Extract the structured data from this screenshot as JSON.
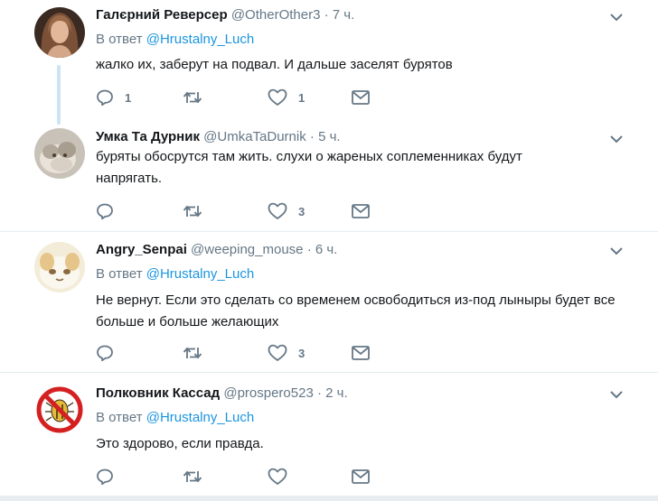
{
  "tweets": [
    {
      "name": "Галєрний Реверсер",
      "handle": "@OtherOther3",
      "dot": "·",
      "time": "7 ч.",
      "reply_prefix": "В ответ",
      "reply_mention": "@Hrustalny_Luch",
      "text": "жалко их, заберут на подвал. И дальше заселят бурятов",
      "replies": "1",
      "retweets": "",
      "likes": "1"
    },
    {
      "name": "Умка Та Дурник",
      "handle": "@UmkaTaDurnik",
      "dot": "·",
      "time": "5 ч.",
      "text": "буряты обосрутся там жить. слухи о жареных соплеменниках будут напрягать.",
      "replies": "",
      "retweets": "",
      "likes": "3"
    },
    {
      "name": "Angry_Senpai",
      "handle": "@weeping_mouse",
      "dot": "·",
      "time": "6 ч.",
      "reply_prefix": "В ответ",
      "reply_mention": "@Hrustalny_Luch",
      "text": "Не вернут. Если это сделать со временем освободиться из-под лыныры будет все больше и больше желающих",
      "replies": "",
      "retweets": "",
      "likes": "3"
    },
    {
      "name": "Полковник Кассад",
      "handle": "@prospero523",
      "dot": "·",
      "time": "2 ч.",
      "reply_prefix": "В ответ",
      "reply_mention": "@Hrustalny_Luch",
      "text": "Это здорово, если правда.",
      "replies": "",
      "retweets": "",
      "likes": ""
    }
  ],
  "icons": {
    "reply": "reply-icon",
    "retweet": "retweet-icon",
    "like": "heart-icon",
    "dm": "envelope-icon",
    "caret": "chevron-down-icon"
  },
  "colors": {
    "name": "#14171a",
    "secondary": "#657786",
    "mention": "#1b95e0",
    "thread_line": "#cce4f5",
    "separator": "#e6ecf0"
  }
}
